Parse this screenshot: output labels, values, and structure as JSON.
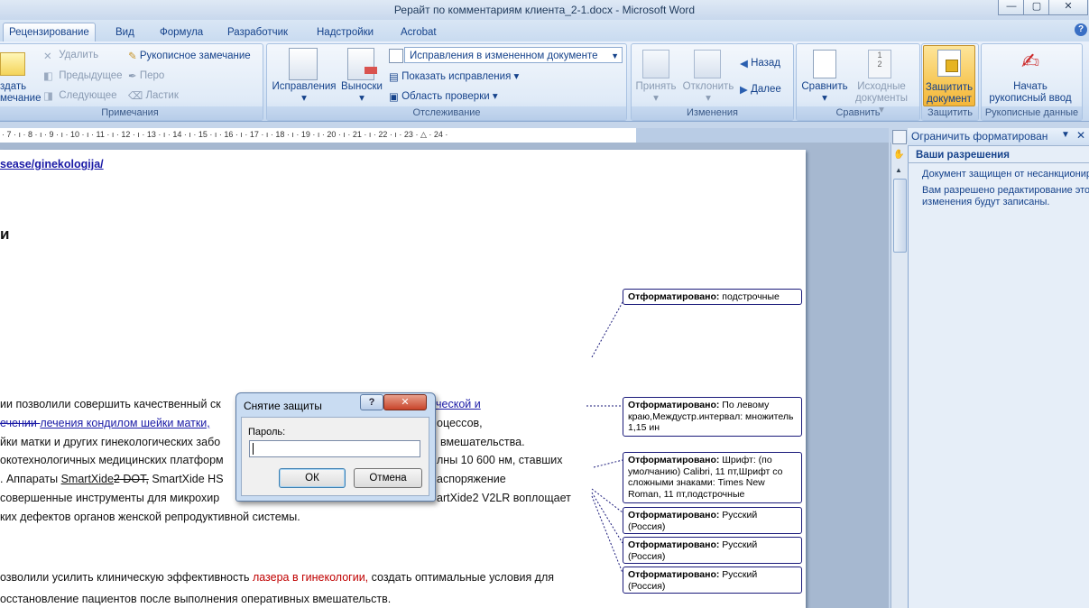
{
  "window": {
    "title": "Рерайт по комментариям клиента_2-1.docx - Microsoft Word",
    "btn_min": "—",
    "btn_max": "▢",
    "btn_close": "✕"
  },
  "tabs": [
    {
      "label": "Рецензирование",
      "active": true
    },
    {
      "label": "Вид"
    },
    {
      "label": "Формула"
    },
    {
      "label": "Разработчик"
    },
    {
      "label": "Надстройки"
    },
    {
      "label": "Acrobat"
    }
  ],
  "help_icon": "?",
  "ribbon": {
    "comments": {
      "create_l1": "здать",
      "create_l2": "мечание",
      "delete": "Удалить",
      "prev": "Предыдущее",
      "next": "Следующее",
      "ink": "Рукописное замечание",
      "pen": "Перо",
      "eraser": "Ластик",
      "label": "Примечания"
    },
    "tracking": {
      "track": "Исправления",
      "balloons": "Выноски",
      "display_select": "Исправления в измененном документе",
      "show_markup": "Показать исправления",
      "pane": "Область проверки",
      "label": "Отслеживание"
    },
    "changes": {
      "accept": "Принять",
      "reject": "Отклонить",
      "back": "Назад",
      "forward": "Далее",
      "label": "Изменения"
    },
    "compare": {
      "compare": "Сравнить",
      "source_l1": "Исходные",
      "source_l2": "документы",
      "label": "Сравнить"
    },
    "protect": {
      "protect_l1": "Защитить",
      "protect_l2": "документ",
      "label": "Защитить"
    },
    "ink": {
      "start_l1": "Начать",
      "start_l2": "рукописный ввод",
      "label": "Рукописные данные"
    }
  },
  "ruler": {
    "marks": "· 7 · ı · 8 · ı · 9 · ı · 10 · ı · 11 · ı · 12 · ı · 13 · ı · 14 · ı · 15 · ı · 16 · ı · 17 · ı · 18 · ı · 19 · ı · 20 · ı · 21 · ı · 22 · ı · 23 · △ · 24 ·"
  },
  "document": {
    "link_line": "sease/ginekologija/",
    "heading_frag": "и",
    "p1_a": "ии позволили совершить качественный ск",
    "p1_link": "ческой и",
    "p2_strike": "ечении ",
    "p2_link": "лечения кондилом шейки матки,",
    "p2_rest": "оцессов,",
    "p3_a": "йки матки и других гинекологических забо",
    "p3_b": "вмешательства.",
    "p4_a": "окотехнологичных медицинских платформ",
    "p4_b": "лны 10 600 нм, ставших",
    "p5_a": ". Аппараты ",
    "p5_b": "SmartXide",
    "p5_c": "2 DOT,",
    "p5_d": "  SmartXide HS",
    "p5_e": "аспоряжение",
    "p6_a": "совершенные инструменты для микрохир",
    "p6_b": "artXide2 V2LR воплощает",
    "p7": "ких дефектов органов женской репродуктивной системы.",
    "p8_a": "озволили усилить клиническую эффективность ",
    "p8_red": "лазера в гинекологии,",
    "p8_b": " создать оптимальные условия для",
    "p9": "осстановление пациентов после выполнения оперативных вмешательств."
  },
  "balloons": [
    {
      "title": "Отформатировано:",
      "text": " подстрочные"
    },
    {
      "title": "Отформатировано:",
      "text": " По левому краю,Междустр.интервал: множитель 1,15 ин"
    },
    {
      "title": "Отформатировано:",
      "text": " Шрифт: (по умолчанию) Calibri, 11 пт,Шрифт со сложными знаками: Times New Roman, 11 пт,подстрочные"
    },
    {
      "title": "Отформатировано:",
      "text": " Русский (Россия)"
    },
    {
      "title": "Отформатировано:",
      "text": " Русский (Россия)"
    },
    {
      "title": "Отформатировано:",
      "text": " Русский (Россия)"
    }
  ],
  "task_pane": {
    "title": "Ограничить форматирован",
    "section": "Ваши разрешения",
    "line1": "Документ защищен от несанкционир",
    "line2": "Вам разрешено редактирование это",
    "line3": "изменения будут записаны."
  },
  "dialog": {
    "title": "Снятие защиты",
    "help": "?",
    "close": "✕",
    "password_label": "Пароль:",
    "password_value": "",
    "ok": "ОК",
    "cancel": "Отмена"
  },
  "colors": {
    "accent": "#15428b",
    "ribbon": "#dfeaf7",
    "protect_active": "#f7c95a",
    "balloon_border": "#1a1a7a"
  }
}
